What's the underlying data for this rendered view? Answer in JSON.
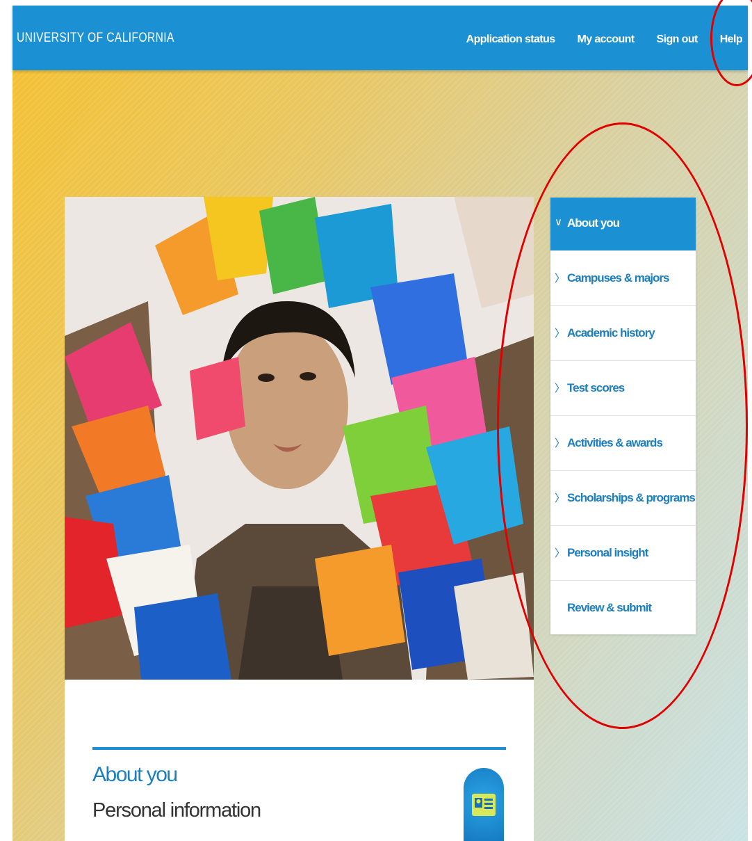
{
  "header": {
    "brand": "UNIVERSITY OF CALIFORNIA",
    "links": [
      "Application status",
      "My account",
      "Sign out",
      "Help"
    ]
  },
  "side_nav": {
    "items": [
      {
        "label": "About you",
        "chevron": "chevron-down",
        "active": true
      },
      {
        "label": "Campuses & majors",
        "chevron": "chevron-right",
        "active": false
      },
      {
        "label": "Academic history",
        "chevron": "chevron-right",
        "active": false
      },
      {
        "label": "Test scores",
        "chevron": "chevron-right",
        "active": false
      },
      {
        "label": "Activities & awards",
        "chevron": "chevron-right",
        "active": false
      },
      {
        "label": "Scholarships & programs",
        "chevron": "chevron-right",
        "active": false
      },
      {
        "label": "Personal insight",
        "chevron": "chevron-right",
        "active": false
      },
      {
        "label": "Review & submit",
        "chevron": "",
        "active": false
      }
    ]
  },
  "main": {
    "section_title": "About you",
    "section_subtitle": "Personal information",
    "icon": "id-card-icon"
  },
  "colors": {
    "brand_blue": "#1b91d3",
    "annotation_red": "#e00000"
  }
}
